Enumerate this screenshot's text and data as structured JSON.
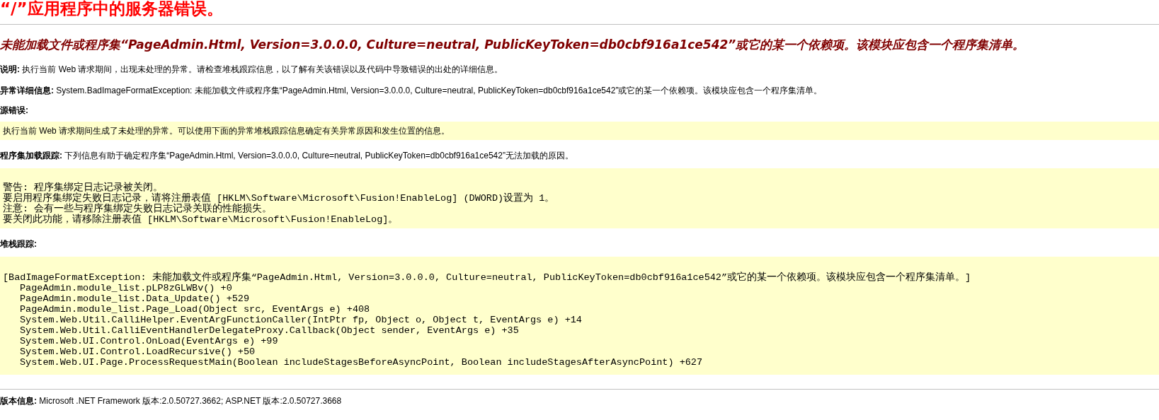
{
  "title": "“/”应用程序中的服务器错误。",
  "error_heading": "未能加载文件或程序集“PageAdmin.Html, Version=3.0.0.0, Culture=neutral, PublicKeyToken=db0cbf916a1ce542”或它的某一个依赖项。该模块应包含一个程序集清单。",
  "description": "**说明:** 执行当前 Web 请求期间，出现未处理的异常。请检查堆栈跟踪信息，以了解有关该错误以及代码中导致错误的出处的详细信息。",
  "exception_details": "**异常详细信息:** System.BadImageFormatException: 未能加载文件或程序集“PageAdmin.Html, Version=3.0.0.0, Culture=neutral, PublicKeyToken=db0cbf916a1ce542”或它的某一个依赖项。该模块应包含一个程序集清单。",
  "source_error": {
    "label": "源错误:",
    "message": "执行当前 Web 请求期间生成了未处理的异常。可以使用下面的异常堆栈跟踪信息确定有关异常原因和发生位置的信息。"
  },
  "assembly_load_trace": {
    "text": "**程序集加载跟踪:** 下列信息有助于确定程序集“PageAdmin.Html, Version=3.0.0.0, Culture=neutral, PublicKeyToken=db0cbf916a1ce542”无法加载的原因。",
    "lines": [
      "警告: 程序集绑定日志记录被关闭。",
      "要启用程序集绑定失败日志记录，请将注册表值 [HKLM\\Software\\Microsoft\\Fusion!EnableLog] (DWORD)设置为 1。",
      "注意: 会有一些与程序集绑定失败日志记录关联的性能损失。",
      "要关闭此功能，请移除注册表值 [HKLM\\Software\\Microsoft\\Fusion!EnableLog]。"
    ]
  },
  "stack_trace": {
    "label": "堆栈跟踪:",
    "exception": "[BadImageFormatException: 未能加载文件或程序集“PageAdmin.Html, Version=3.0.0.0, Culture=neutral, PublicKeyToken=db0cbf916a1ce542”或它的某一个依赖项。该模块应包含一个程序集清单。]",
    "frames": [
      "PageAdmin.module_list.pLP8zGLWBv() +0",
      "PageAdmin.module_list.Data_Update() +529",
      "PageAdmin.module_list.Page_Load(Object src, EventArgs e) +408",
      "System.Web.Util.CalliHelper.EventArgFunctionCaller(IntPtr fp, Object o, Object t, EventArgs e) +14",
      "System.Web.Util.CalliEventHandlerDelegateProxy.Callback(Object sender, EventArgs e) +35",
      "System.Web.UI.Control.OnLoad(EventArgs e) +99",
      "System.Web.UI.Control.LoadRecursive() +50",
      "System.Web.UI.Page.ProcessRequestMain(Boolean includeStagesBeforeAsyncPoint, Boolean includeStagesAfterAsyncPoint) +627"
    ]
  },
  "version_info": "**版本信息:** Microsoft .NET Framework 版本:2.0.50727.3662; ASP.NET 版本:2.0.50727.3668"
}
